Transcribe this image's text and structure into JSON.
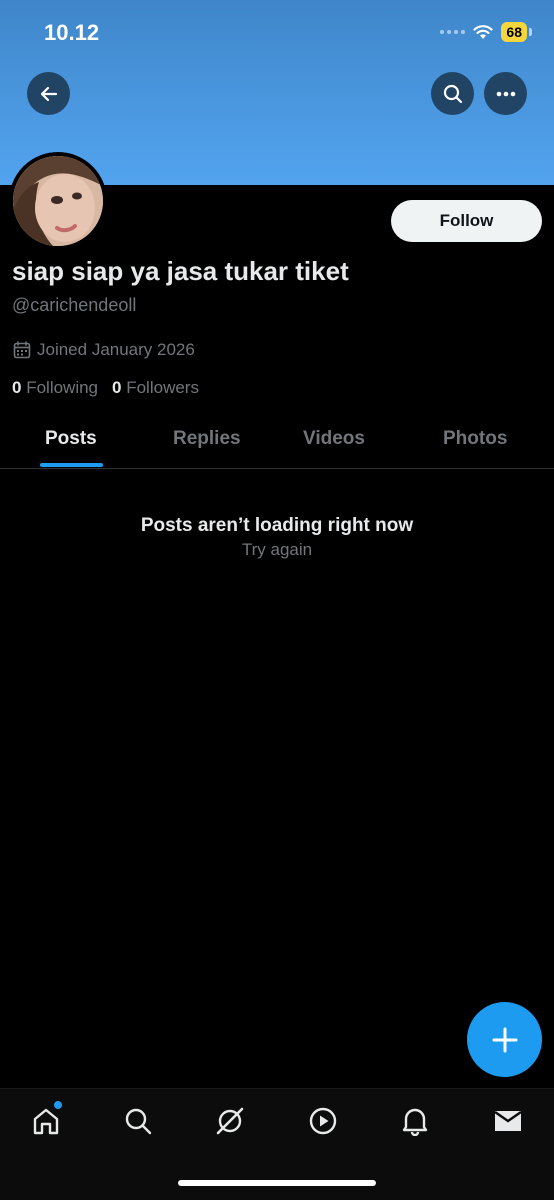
{
  "status_bar": {
    "time": "10.12",
    "battery": "68"
  },
  "header": {
    "back_icon": "arrow-left-icon",
    "search_icon": "search-icon",
    "more_icon": "more-horizontal-icon"
  },
  "profile": {
    "display_name": "siap siap ya jasa tukar tiket",
    "handle": "@carichendeoll",
    "joined": "Joined January 2026",
    "following_count": "0",
    "following_label": "Following",
    "followers_count": "0",
    "followers_label": "Followers",
    "follow_label": "Follow"
  },
  "tabs": [
    {
      "label": "Posts",
      "active": true
    },
    {
      "label": "Replies"
    },
    {
      "label": "Videos"
    },
    {
      "label": "Photos"
    }
  ],
  "empty_state": {
    "title": "Posts aren’t loading right now",
    "action": "Try again"
  },
  "fab": {
    "icon": "plus-icon"
  },
  "bottom_nav": [
    "home-icon",
    "search-icon",
    "grok-icon",
    "play-icon",
    "bell-icon",
    "mail-icon"
  ],
  "colors": {
    "accent": "#1d9bf0",
    "banner": "#4a97df",
    "background": "#000000",
    "muted": "#71767b"
  }
}
